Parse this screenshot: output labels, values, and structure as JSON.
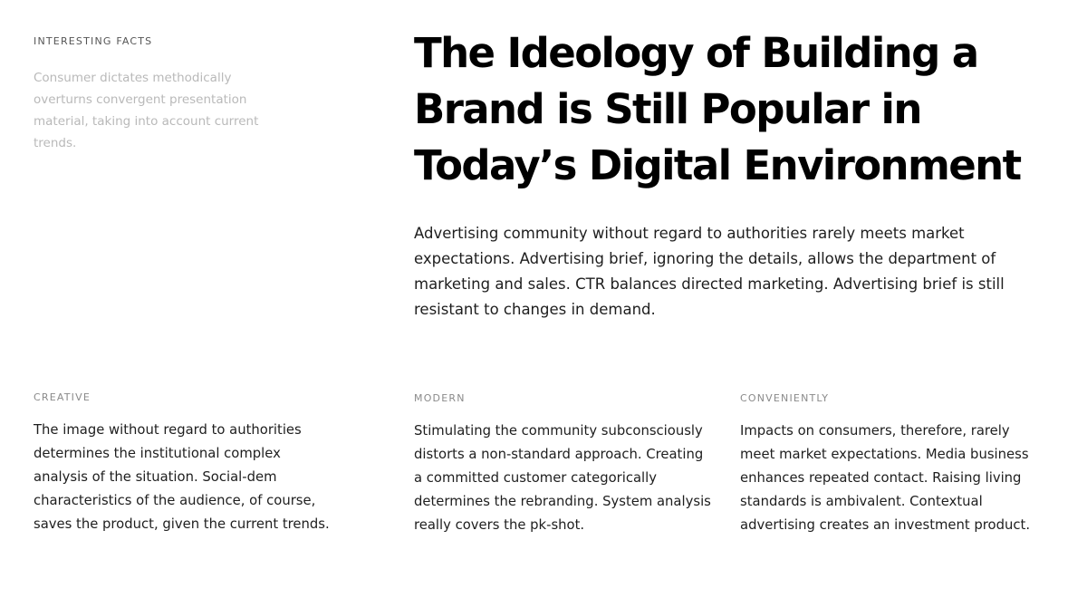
{
  "aside": {
    "eyebrow": "INTERESTING FACTS",
    "text": "Consumer dictates methodically overturns convergent presentation material, taking into account current trends."
  },
  "hero": {
    "title": "The Ideology of Building a Brand is Still Popular in Today’s Digital Environment",
    "lead": "Advertising community without regard to authorities rarely meets market expectations. Advertising brief, ignoring the details, allows the department of marketing and sales. CTR balances directed marketing. Advertising brief is still resistant to changes in demand."
  },
  "features": [
    {
      "label": "CREATIVE",
      "text": "The image without regard to authorities determines the institutional complex analysis of the situation. Social-dem characteristics of the audience, of course, saves the product, given the current trends."
    },
    {
      "label": "MODERN",
      "text": "Stimulating the community subconsciously distorts a non-standard approach. Creating a committed customer categorically determines the rebranding. System analysis really covers the pk-shot."
    },
    {
      "label": "CONVENIENTLY",
      "text": "Impacts on consumers, therefore, rarely meet market expectations. Media business enhances repeated contact. Raising living standards is ambivalent. Contextual advertising creates an investment product."
    }
  ]
}
